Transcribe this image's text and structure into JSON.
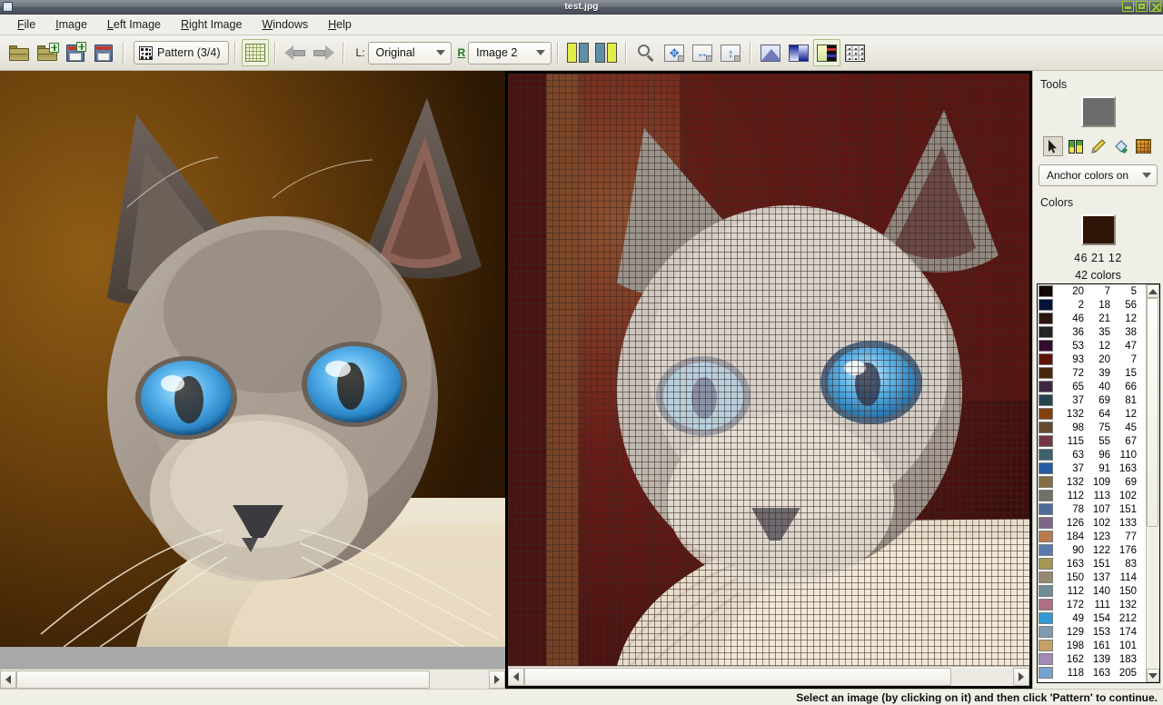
{
  "window": {
    "title": "test.jpg",
    "app_icon": "window-icon",
    "buttons": {
      "minimize": "minimize-button",
      "maximize": "maximize-button",
      "close": "close-button"
    }
  },
  "menubar": {
    "items": [
      {
        "label": "File",
        "accel": "F"
      },
      {
        "label": "Image",
        "accel": "I"
      },
      {
        "label": "Left Image",
        "accel": "L"
      },
      {
        "label": "Right Image",
        "accel": "R"
      },
      {
        "label": "Windows",
        "accel": "W"
      },
      {
        "label": "Help",
        "accel": "H"
      }
    ]
  },
  "toolbar": {
    "open_label": "Open",
    "open_new_label": "Open new",
    "save_as_label": "Save as",
    "save_label": "Save",
    "pattern_label": "Pattern (3/4)",
    "grid_label": "Grid",
    "back_label": "Back",
    "forward_label": "Forward",
    "left_combo": {
      "prefix": "L:",
      "value": "Original"
    },
    "right_combo": {
      "prefix": "R",
      "value": "Image 2"
    },
    "split_left_label": "Left view",
    "split_right_label": "Right view",
    "zoom_label": "Zoom",
    "fit_both_label": "Fit both",
    "fit_width_label": "Fit width",
    "fit_height_label": "Fit height",
    "histogram_label": "Histogram",
    "gradient_label": "Gradient",
    "palette_label": "Palette",
    "mosaic_label": "Mosaic"
  },
  "side": {
    "tools_title": "Tools",
    "current_tool_swatch": "#6b6b6b",
    "tools": [
      {
        "name": "select-tool",
        "label": "Select"
      },
      {
        "name": "swap-tool",
        "label": "Swap colors"
      },
      {
        "name": "pencil-tool",
        "label": "Pencil"
      },
      {
        "name": "bucket-tool",
        "label": "Fill"
      },
      {
        "name": "palette-tool",
        "label": "Palette"
      }
    ],
    "anchor_combo": "Anchor colors on",
    "colors_title": "Colors",
    "current_color_swatch": "#2e1508",
    "current_color_rgb": "46  21  12",
    "color_count": "42 colors"
  },
  "colors": [
    {
      "rgb": "20   7   5",
      "hex": "#140705",
      "r": 20,
      "g": 7,
      "b": 5
    },
    {
      "rgb": " 2  18  56",
      "hex": "#021238",
      "r": 2,
      "g": 18,
      "b": 56
    },
    {
      "rgb": "46  21  12",
      "hex": "#2e150c",
      "r": 46,
      "g": 21,
      "b": 12
    },
    {
      "rgb": "36  35  38",
      "hex": "#242326",
      "r": 36,
      "g": 35,
      "b": 38
    },
    {
      "rgb": "53  12  47",
      "hex": "#350c2f",
      "r": 53,
      "g": 12,
      "b": 47
    },
    {
      "rgb": "93  20   7",
      "hex": "#5d1407",
      "r": 93,
      "g": 20,
      "b": 7
    },
    {
      "rgb": "72  39  15",
      "hex": "#48270f",
      "r": 72,
      "g": 39,
      "b": 15
    },
    {
      "rgb": "65  40  66",
      "hex": "#412842",
      "r": 65,
      "g": 40,
      "b": 66
    },
    {
      "rgb": "37  69  81",
      "hex": "#254551",
      "r": 37,
      "g": 69,
      "b": 81
    },
    {
      "rgb": "132  64  12",
      "hex": "#84400c",
      "r": 132,
      "g": 64,
      "b": 12
    },
    {
      "rgb": "98  75  45",
      "hex": "#624b2d",
      "r": 98,
      "g": 75,
      "b": 45
    },
    {
      "rgb": "115  55  67",
      "hex": "#733743",
      "r": 115,
      "g": 55,
      "b": 67
    },
    {
      "rgb": "63  96 110",
      "hex": "#3f606e",
      "r": 63,
      "g": 96,
      "b": 110
    },
    {
      "rgb": "37  91 163",
      "hex": "#255ba3",
      "r": 37,
      "g": 91,
      "b": 163
    },
    {
      "rgb": "132 109  69",
      "hex": "#846d45",
      "r": 132,
      "g": 109,
      "b": 69
    },
    {
      "rgb": "112 113 102",
      "hex": "#707166",
      "r": 112,
      "g": 113,
      "b": 102
    },
    {
      "rgb": "78 107 151",
      "hex": "#4e6b97",
      "r": 78,
      "g": 107,
      "b": 151
    },
    {
      "rgb": "126 102 133",
      "hex": "#7e6685",
      "r": 126,
      "g": 102,
      "b": 133
    },
    {
      "rgb": "184 123  77",
      "hex": "#b87b4d",
      "r": 184,
      "g": 123,
      "b": 77
    },
    {
      "rgb": "90 122 176",
      "hex": "#5a7ab0",
      "r": 90,
      "g": 122,
      "b": 176
    },
    {
      "rgb": "163 151  83",
      "hex": "#a39753",
      "r": 163,
      "g": 151,
      "b": 83
    },
    {
      "rgb": "150 137 114",
      "hex": "#968972",
      "r": 150,
      "g": 137,
      "b": 114
    },
    {
      "rgb": "112 140 150",
      "hex": "#708c96",
      "r": 112,
      "g": 140,
      "b": 150
    },
    {
      "rgb": "172 111 132",
      "hex": "#ac6f84",
      "r": 172,
      "g": 111,
      "b": 132
    },
    {
      "rgb": "49 154 212",
      "hex": "#319ad4",
      "r": 49,
      "g": 154,
      "b": 212
    },
    {
      "rgb": "129 153 174",
      "hex": "#8199ae",
      "r": 129,
      "g": 153,
      "b": 174
    },
    {
      "rgb": "198 161 101",
      "hex": "#c6a165",
      "r": 198,
      "g": 161,
      "b": 101
    },
    {
      "rgb": "162 139 183",
      "hex": "#a28bb7",
      "r": 162,
      "g": 139,
      "b": 183
    },
    {
      "rgb": "118 163 205",
      "hex": "#76a3cd",
      "r": 118,
      "g": 163,
      "b": 205
    }
  ],
  "panes": {
    "left_image_alt": "Siamese cat portrait with blue eyes on brown background",
    "right_image_alt": "Pixelated pattern preview of the cat image with grid overlay"
  },
  "statusbar": {
    "message": "Select an image (by clicking on it) and then click 'Pattern' to continue."
  }
}
